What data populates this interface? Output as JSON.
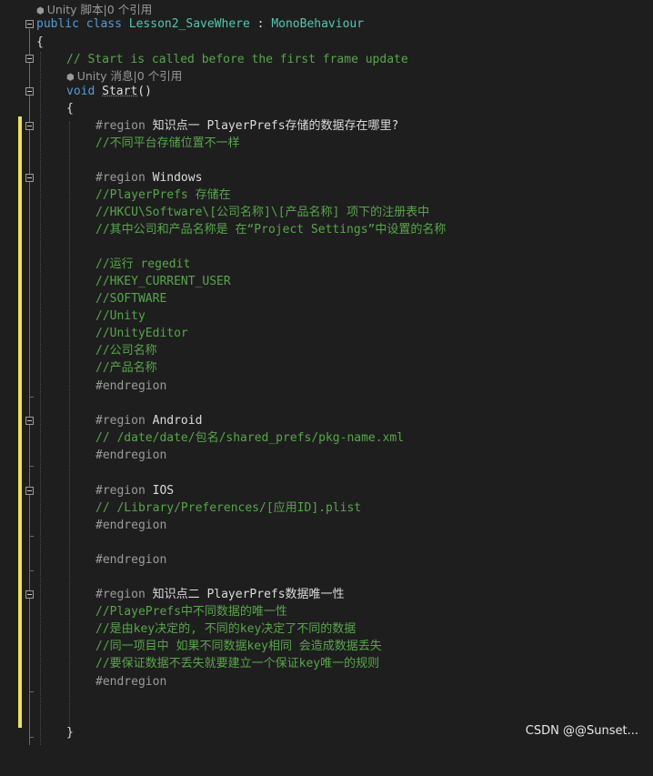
{
  "editor": {
    "codelens_class": "Unity 脚本|0 个引用",
    "class_decl": {
      "kw1": "public",
      "kw2": "class",
      "name": "Lesson2_SaveWhere",
      "sep": " : ",
      "base": "MonoBehaviour"
    },
    "brace_open": "{",
    "comment_start": "// Start is called before the first frame update",
    "codelens_method": "Unity 消息|0 个引用",
    "method_decl": {
      "kw": "void",
      "name": "Start",
      "parens": "()"
    },
    "method_brace_open": "{",
    "region1": {
      "directive": "#region",
      "name": "知识点一 PlayerPrefs存储的数据存在哪里?"
    },
    "r1_comment": "//不同平台存储位置不一样",
    "region_windows": {
      "directive": "#region",
      "name": "Windows"
    },
    "win_c1": "//PlayerPrefs 存储在",
    "win_c2": "//HKCU\\Software\\[公司名称]\\[产品名称] 项下的注册表中",
    "win_c3": "//其中公司和产品名称是 在“Project Settings”中设置的名称",
    "win_c4": "//运行 regedit",
    "win_c5": "//HKEY_CURRENT_USER",
    "win_c6": "//SOFTWARE",
    "win_c7": "//Unity",
    "win_c8": "//UnityEditor",
    "win_c9": "//公司名称",
    "win_c10": "//产品名称",
    "endregion": "#endregion",
    "region_android": {
      "directive": "#region",
      "name": "Android"
    },
    "android_c1": "// /date/date/包名/shared_prefs/pkg-name.xml",
    "region_ios": {
      "directive": "#region",
      "name": "IOS"
    },
    "ios_c1": "// /Library/Preferences/[应用ID].plist",
    "region2": {
      "directive": "#region",
      "name": "知识点二 PlayerPrefs数据唯一性"
    },
    "r2_c1": "//PlayePrefs中不同数据的唯一性",
    "r2_c2": "//是由key决定的, 不同的key决定了不同的数据",
    "r2_c3": "//同一项目中 如果不同数据key相同 会造成数据丢失",
    "r2_c4": "//要保证数据不丢失就要建立一个保证key唯一的规则",
    "method_brace_close": "}"
  },
  "watermark": "CSDN @@Sunset...",
  "colors": {
    "background": "#1e1e1e",
    "keyword": "#569cd6",
    "type": "#4ec9b0",
    "comment": "#57a64a",
    "preprocessor": "#9b9b9b",
    "change_bar": "#e6e655"
  },
  "icons": {
    "codelens": "unity-cube-icon",
    "fold": "collapse-minus-icon"
  }
}
